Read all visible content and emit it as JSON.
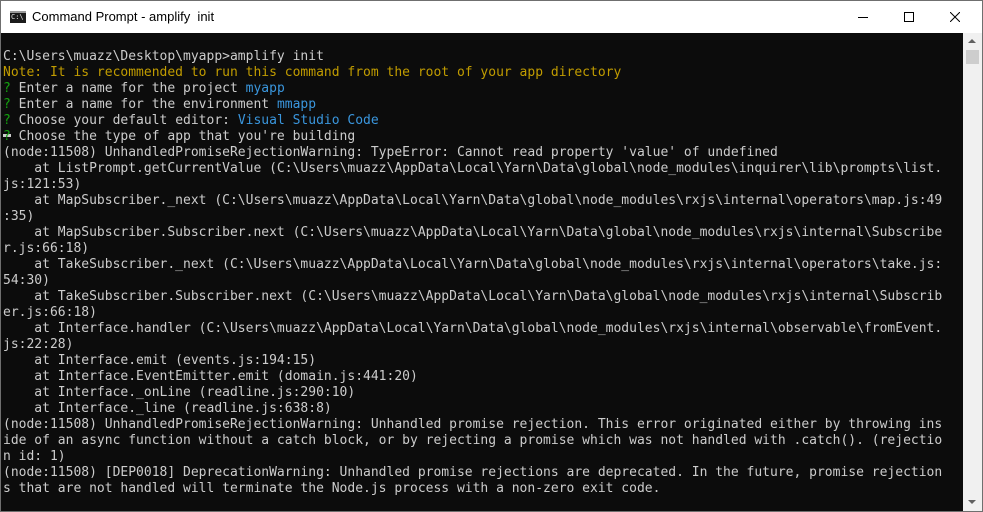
{
  "window": {
    "title": "Command Prompt - amplify  init",
    "app_icon_glyph": "C:\\",
    "icons": {
      "minimize": "minimize-icon",
      "maximize": "maximize-icon",
      "close": "close-icon"
    }
  },
  "colors": {
    "console_bg": "#0c0c0c",
    "text": "#cccccc",
    "note": "#c19c00",
    "prompt_marker": "#13a10e",
    "answer": "#3a96dd"
  },
  "console": {
    "command_line": "C:\\Users\\muazz\\Desktop\\myapp>amplify init",
    "note": "Note: It is recommended to run this command from the root of your app directory",
    "prompts": [
      {
        "marker": "?",
        "question": " Enter a name for the project ",
        "answer": "myapp"
      },
      {
        "marker": "?",
        "question": " Enter a name for the environment ",
        "answer": "mmapp"
      },
      {
        "marker": "?",
        "question": " Choose your default editor: ",
        "answer": "Visual Studio Code"
      },
      {
        "marker": "?",
        "question": " Choose the type of app that you're building",
        "answer": ""
      }
    ],
    "output_lines": [
      "(node:11508) UnhandledPromiseRejectionWarning: TypeError: Cannot read property 'value' of undefined",
      "    at ListPrompt.getCurrentValue (C:\\Users\\muazz\\AppData\\Local\\Yarn\\Data\\global\\node_modules\\inquirer\\lib\\prompts\\list.",
      "js:121:53)",
      "    at MapSubscriber._next (C:\\Users\\muazz\\AppData\\Local\\Yarn\\Data\\global\\node_modules\\rxjs\\internal\\operators\\map.js:49",
      ":35)",
      "    at MapSubscriber.Subscriber.next (C:\\Users\\muazz\\AppData\\Local\\Yarn\\Data\\global\\node_modules\\rxjs\\internal\\Subscribe",
      "r.js:66:18)",
      "    at TakeSubscriber._next (C:\\Users\\muazz\\AppData\\Local\\Yarn\\Data\\global\\node_modules\\rxjs\\internal\\operators\\take.js:",
      "54:30)",
      "    at TakeSubscriber.Subscriber.next (C:\\Users\\muazz\\AppData\\Local\\Yarn\\Data\\global\\node_modules\\rxjs\\internal\\Subscrib",
      "er.js:66:18)",
      "    at Interface.handler (C:\\Users\\muazz\\AppData\\Local\\Yarn\\Data\\global\\node_modules\\rxjs\\internal\\observable\\fromEvent.",
      "js:22:28)",
      "    at Interface.emit (events.js:194:15)",
      "    at Interface.EventEmitter.emit (domain.js:441:20)",
      "    at Interface._onLine (readline.js:290:10)",
      "    at Interface._line (readline.js:638:8)",
      "(node:11508) UnhandledPromiseRejectionWarning: Unhandled promise rejection. This error originated either by throwing ins",
      "ide of an async function without a catch block, or by rejecting a promise which was not handled with .catch(). (rejectio",
      "n id: 1)",
      "(node:11508) [DEP0018] DeprecationWarning: Unhandled promise rejections are deprecated. In the future, promise rejection",
      "s that are not handled will terminate the Node.js process with a non-zero exit code."
    ]
  }
}
